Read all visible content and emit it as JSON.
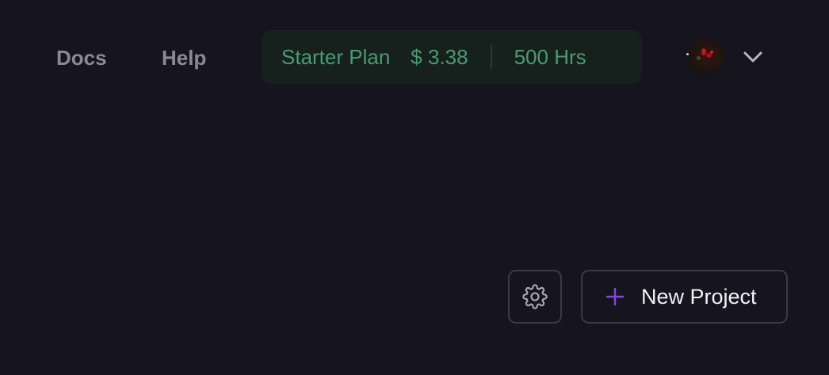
{
  "header": {
    "nav": {
      "docs_label": "Docs",
      "help_label": "Help"
    },
    "plan": {
      "name": "Starter Plan",
      "price": "$ 3.38",
      "hours": "500 Hrs"
    },
    "user_menu": {
      "avatar_icon": "user-avatar",
      "dropdown_icon": "chevron-down-icon"
    }
  },
  "toolbar": {
    "settings_icon": "gear-icon",
    "new_project_label": "New Project",
    "new_project_icon": "plus-icon"
  },
  "colors": {
    "background": "#15141f",
    "nav_text": "#8a8995",
    "plan_bg": "#16211d",
    "plan_text": "#4a9a72",
    "accent_purple": "#7c4ddb",
    "button_border": "#3a3946"
  }
}
